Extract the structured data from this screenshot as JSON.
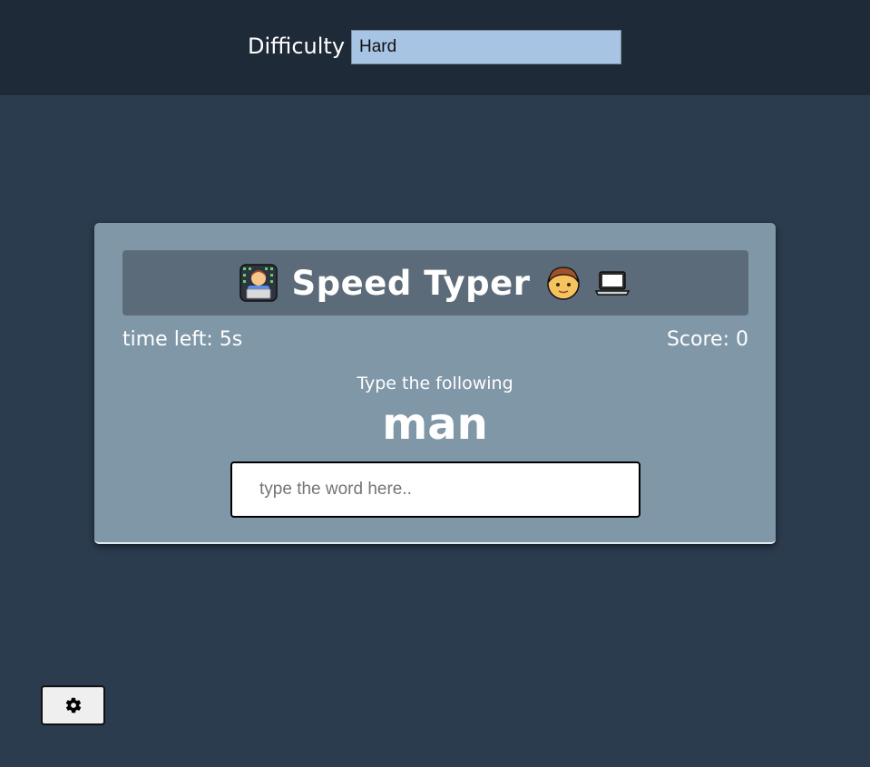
{
  "settings": {
    "difficulty_label": "Difficulty",
    "difficulty_value": "Hard",
    "settings_button_icon": "gear-icon"
  },
  "game": {
    "title": "Speed Typer",
    "title_icons": [
      "technologist-icon",
      "boy-icon",
      "laptop-icon"
    ],
    "time_left": "time left: 5s",
    "score": "Score: 0",
    "instruction": "Type the following",
    "word": "man",
    "input_placeholder": "type the word here..",
    "input_value": ""
  },
  "colors": {
    "background": "#2c3c4f",
    "top_bar": "#1f2a39",
    "card": "#8097a8",
    "title_box": "#5c6b79",
    "select_bg": "#a7c4e4"
  }
}
